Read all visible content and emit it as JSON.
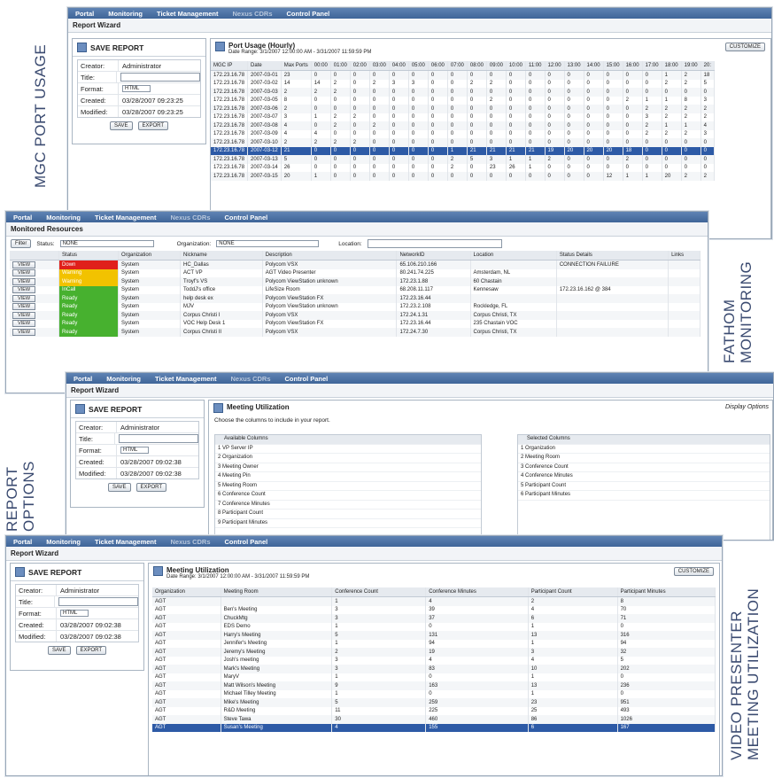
{
  "labels": {
    "mgc": "MGC PORT USAGE",
    "fathom_1": "FATHOM",
    "fathom_2": "MONITORING",
    "report_1": "REPORT",
    "report_2": "OPTIONS",
    "vp_1": "VIDEO PRESENTER",
    "vp_2": "MEETING UTILIZATION"
  },
  "nav": [
    "Portal",
    "Monitoring",
    "Ticket Management",
    "Nexus CDRs",
    "Control Panel"
  ],
  "report_wizard": "Report Wizard",
  "save_report": {
    "title": "SAVE REPORT",
    "creator_label": "Creator:",
    "creator": "Administrator",
    "title_label": "Title:",
    "format_label": "Format:",
    "format": "HTML",
    "created_label": "Created:",
    "modified_label": "Modified:",
    "save": "SAVE",
    "export": "EXPORT"
  },
  "panel1": {
    "created": "03/28/2007 09:23:25",
    "modified": "03/28/2007 09:23:25",
    "title": "Port Usage (Hourly)",
    "range": "Date Range: 3/1/2007 12:00:00 AM - 3/31/2007 11:59:59 PM",
    "customize": "CUSTOMIZE",
    "headers": [
      "MGC IP",
      "Date",
      "Max Ports",
      "00:00",
      "01:00",
      "02:00",
      "03:00",
      "04:00",
      "05:00",
      "06:00",
      "07:00",
      "08:00",
      "09:00",
      "10:00",
      "11:00",
      "12:00",
      "13:00",
      "14:00",
      "15:00",
      "16:00",
      "17:00",
      "18:00",
      "19:00",
      "20:"
    ],
    "rows": [
      [
        "172.23.16.78",
        "2007-03-01",
        "23",
        "0",
        "0",
        "0",
        "0",
        "0",
        "0",
        "0",
        "0",
        "0",
        "0",
        "0",
        "0",
        "0",
        "0",
        "0",
        "0",
        "0",
        "0",
        "1",
        "2",
        "18"
      ],
      [
        "172.23.16.78",
        "2007-03-02",
        "14",
        "14",
        "2",
        "0",
        "2",
        "3",
        "3",
        "0",
        "0",
        "2",
        "2",
        "0",
        "0",
        "0",
        "0",
        "0",
        "0",
        "0",
        "0",
        "2",
        "2",
        "5"
      ],
      [
        "172.23.16.78",
        "2007-03-03",
        "2",
        "2",
        "2",
        "0",
        "0",
        "0",
        "0",
        "0",
        "0",
        "0",
        "0",
        "0",
        "0",
        "0",
        "0",
        "0",
        "0",
        "0",
        "0",
        "0",
        "0",
        "0"
      ],
      [
        "172.23.16.78",
        "2007-03-05",
        "8",
        "0",
        "0",
        "0",
        "0",
        "0",
        "0",
        "0",
        "0",
        "0",
        "2",
        "0",
        "0",
        "0",
        "0",
        "0",
        "0",
        "2",
        "1",
        "1",
        "8",
        "3"
      ],
      [
        "172.23.16.78",
        "2007-03-06",
        "2",
        "0",
        "0",
        "0",
        "0",
        "0",
        "0",
        "0",
        "0",
        "0",
        "0",
        "0",
        "0",
        "0",
        "0",
        "0",
        "0",
        "0",
        "2",
        "2",
        "2",
        "2"
      ],
      [
        "172.23.16.78",
        "2007-03-07",
        "3",
        "1",
        "2",
        "2",
        "0",
        "0",
        "0",
        "0",
        "0",
        "0",
        "0",
        "0",
        "0",
        "0",
        "0",
        "0",
        "0",
        "0",
        "3",
        "2",
        "2",
        "2"
      ],
      [
        "172.23.16.78",
        "2007-03-08",
        "4",
        "0",
        "2",
        "0",
        "2",
        "0",
        "0",
        "0",
        "0",
        "0",
        "0",
        "0",
        "0",
        "0",
        "0",
        "0",
        "0",
        "0",
        "2",
        "1",
        "1",
        "4"
      ],
      [
        "172.23.16.78",
        "2007-03-09",
        "4",
        "4",
        "0",
        "0",
        "0",
        "0",
        "0",
        "0",
        "0",
        "0",
        "0",
        "0",
        "0",
        "0",
        "0",
        "0",
        "0",
        "0",
        "2",
        "2",
        "2",
        "3"
      ],
      [
        "172.23.16.78",
        "2007-03-10",
        "2",
        "2",
        "2",
        "2",
        "0",
        "0",
        "0",
        "0",
        "0",
        "0",
        "0",
        "0",
        "0",
        "0",
        "0",
        "0",
        "0",
        "0",
        "0",
        "0",
        "0",
        "0"
      ],
      [
        "172.23.16.78",
        "2007-03-12",
        "21",
        "0",
        "0",
        "0",
        "0",
        "0",
        "0",
        "0",
        "1",
        "21",
        "21",
        "21",
        "21",
        "19",
        "20",
        "20",
        "20",
        "18",
        "0",
        "0",
        "0",
        "0"
      ],
      [
        "172.23.16.78",
        "2007-03-13",
        "5",
        "0",
        "0",
        "0",
        "0",
        "0",
        "0",
        "0",
        "2",
        "5",
        "3",
        "1",
        "1",
        "2",
        "0",
        "0",
        "0",
        "2",
        "0",
        "0",
        "0",
        "0"
      ],
      [
        "172.23.16.78",
        "2007-03-14",
        "26",
        "0",
        "0",
        "0",
        "0",
        "0",
        "0",
        "0",
        "2",
        "0",
        "23",
        "26",
        "1",
        "0",
        "0",
        "0",
        "0",
        "0",
        "0",
        "0",
        "0",
        "0"
      ],
      [
        "172.23.16.78",
        "2007-03-15",
        "20",
        "1",
        "0",
        "0",
        "0",
        "0",
        "0",
        "0",
        "0",
        "0",
        "0",
        "0",
        "0",
        "0",
        "0",
        "0",
        "12",
        "1",
        "1",
        "20",
        "2",
        "2"
      ]
    ]
  },
  "panel2": {
    "title": "Monitored Resources",
    "filter": "Filter",
    "status_label": "Status:",
    "status_value": "NONE",
    "org_label": "Organization:",
    "org_value": "NONE",
    "location_label": "Location:",
    "headers": [
      "Status",
      "Organization",
      "Nickname",
      "Description",
      "NetworkID",
      "Location",
      "Status Details",
      "Links"
    ],
    "view": "VIEW",
    "rows": [
      [
        "Down",
        "System",
        "HC_Dallas",
        "Polycom VSX",
        "65.106.210.166",
        "",
        "CONNECTION FAILURE",
        ""
      ],
      [
        "Warning",
        "System",
        "ACT VP",
        "AGT Video Presenter",
        "80.241.74.225",
        "Amsterdam, NL",
        "",
        ""
      ],
      [
        "Warning",
        "System",
        "Troyf's VS",
        "Polycom ViewStation unknown",
        "172.23.1.88",
        "60 Chastain",
        "",
        ""
      ],
      [
        "InCall",
        "System",
        "ToddJ's office",
        "LifeSize Room",
        "68.208.11.117",
        "Kennesaw",
        "172.23.16.162 @ 384",
        ""
      ],
      [
        "Ready",
        "System",
        "help desk ex",
        "Polycom ViewStation FX",
        "172.23.16.44",
        "",
        "",
        ""
      ],
      [
        "Ready",
        "System",
        "MJV",
        "Polycom ViewStation unknown",
        "172.23.2.108",
        "Rockledge, FL",
        "",
        ""
      ],
      [
        "Ready",
        "System",
        "Corpus Christi I",
        "Polycom VSX",
        "172.24.1.31",
        "Corpus Christi, TX",
        "",
        ""
      ],
      [
        "Ready",
        "System",
        "VOC Help Desk 1",
        "Polycom ViewStation FX",
        "172.23.16.44",
        "235 Chastain VOC",
        "",
        ""
      ],
      [
        "Ready",
        "System",
        "Corpus Christi II",
        "Polycom VSX",
        "172.24.7.30",
        "Corpus Christi, TX",
        "",
        ""
      ]
    ]
  },
  "panel3": {
    "created": "03/28/2007 09:02:38",
    "modified": "03/28/2007 09:02:38",
    "title": "Meeting Utilization",
    "display_options": "Display Options",
    "instruction": "Choose the columns to include in your report.",
    "available_header": "Available Columns",
    "selected_header": "Selected Columns",
    "available": [
      "VP Server IP",
      "Organization",
      "Meeting Owner",
      "Meeting Pin",
      "Meeting Room",
      "Conference Count",
      "Conference Minutes",
      "Participant Count",
      "Participant Minutes"
    ],
    "selected": [
      "Organization",
      "Meeting Room",
      "Conference Count",
      "Conference Minutes",
      "Participant Count",
      "Participant Minutes"
    ]
  },
  "panel4": {
    "created": "03/28/2007 09:02:38",
    "modified": "03/28/2007 09:02:38",
    "title": "Meeting Utilization",
    "range": "Date Range: 3/1/2007 12:00:00 AM - 3/31/2007 11:59:59 PM",
    "customize": "CUSTOMIZE",
    "headers": [
      "Organization",
      "Meeting Room",
      "Conference Count",
      "Conference Minutes",
      "Participant Count",
      "Participant Minutes"
    ],
    "rows": [
      [
        "AGT",
        "",
        "1",
        "4",
        "2",
        "8"
      ],
      [
        "AGT",
        "Ben's Meeting",
        "3",
        "39",
        "4",
        "70"
      ],
      [
        "AGT",
        "ChuckMtg",
        "3",
        "37",
        "6",
        "71"
      ],
      [
        "AGT",
        "EDS Demo",
        "1",
        "0",
        "1",
        "0"
      ],
      [
        "AGT",
        "Harry's Meeting",
        "5",
        "131",
        "13",
        "316"
      ],
      [
        "AGT",
        "Jennifer's Meeting",
        "1",
        "94",
        "1",
        "94"
      ],
      [
        "AGT",
        "Jeremy's Meeting",
        "2",
        "19",
        "3",
        "32"
      ],
      [
        "AGT",
        "Josh's meeting",
        "3",
        "4",
        "4",
        "5"
      ],
      [
        "AGT",
        "Mark's Meeting",
        "3",
        "83",
        "10",
        "202"
      ],
      [
        "AGT",
        "MaryV",
        "1",
        "0",
        "1",
        "0"
      ],
      [
        "AGT",
        "Matt Wilson's Meeting",
        "9",
        "163",
        "13",
        "236"
      ],
      [
        "AGT",
        "Michael Tilley Meeting",
        "1",
        "0",
        "1",
        "0"
      ],
      [
        "AGT",
        "Mike's Meeting",
        "5",
        "259",
        "23",
        "951"
      ],
      [
        "AGT",
        "R&D Meeting",
        "11",
        "225",
        "25",
        "493"
      ],
      [
        "AGT",
        "Steve Tawa",
        "30",
        "460",
        "86",
        "1026"
      ],
      [
        "AGT",
        "Susan's Meeting",
        "4",
        "155",
        "6",
        "167"
      ]
    ]
  }
}
